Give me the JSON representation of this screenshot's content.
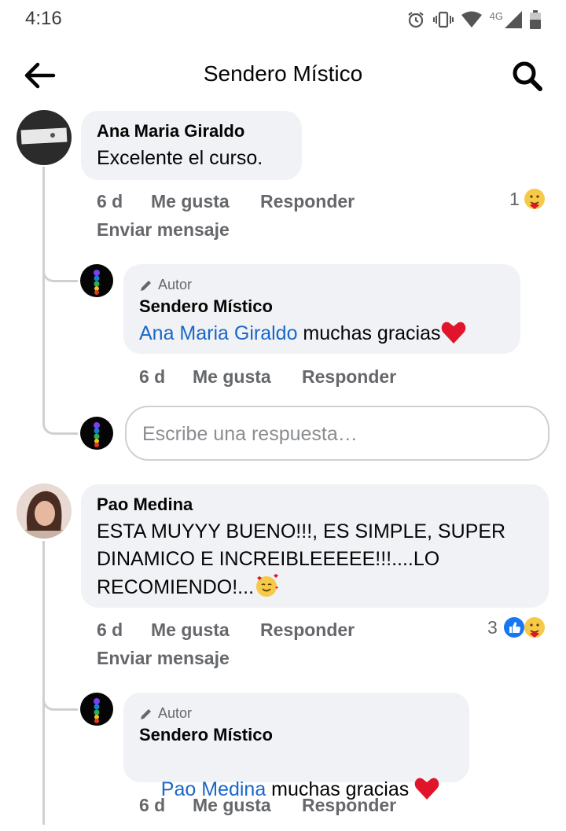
{
  "status_bar": {
    "time": "4:16",
    "network": "4G"
  },
  "header": {
    "title": "Sendero Místico"
  },
  "comments": [
    {
      "author": "Ana Maria Giraldo",
      "text": "Excelente el curso.",
      "time": "6 d",
      "like": "Me gusta",
      "reply": "Responder",
      "message": "Enviar mensaje",
      "reaction_count": "1",
      "reply_item": {
        "tag": "Autor",
        "author": "Sendero Místico",
        "mention": "Ana Maria Giraldo",
        "text": " muchas gracias",
        "time": "6 d",
        "like": "Me gusta",
        "reply": "Responder"
      }
    },
    {
      "author": "Pao Medina",
      "text_lines": [
        "ESTA MUYYY BUENO!!!, ES SIMPLE, SUPER",
        "DINAMICO E INCREIBLEEEEE!!!....LO",
        "RECOMIENDO!..."
      ],
      "time": "6 d",
      "like": "Me gusta",
      "reply": "Responder",
      "message": "Enviar mensaje",
      "reaction_count": "3",
      "reply_item": {
        "tag": "Autor",
        "author": "Sendero Místico",
        "mention": "Pao Medina",
        "text": " muchas gracias ",
        "time": "6 d",
        "like": "Me gusta",
        "reply": "Responder"
      }
    }
  ],
  "reply_box": {
    "placeholder": "Escribe una respuesta…"
  },
  "icons": {
    "back": "arrow-left-icon",
    "search": "search-icon",
    "alarm": "alarm-icon",
    "vibrate": "vibrate-icon",
    "wifi": "wifi-icon",
    "signal": "signal-icon",
    "battery": "battery-icon",
    "pencil": "pencil-icon",
    "heart": "heart-emoji",
    "hug": "hug-emoji",
    "like": "like-icon",
    "love_face": "smiling-hearts-emoji"
  },
  "colors": {
    "link": "#1b67c9",
    "bubble": "#f0f2f5",
    "meta": "#65676b",
    "heart": "#e0142a"
  }
}
